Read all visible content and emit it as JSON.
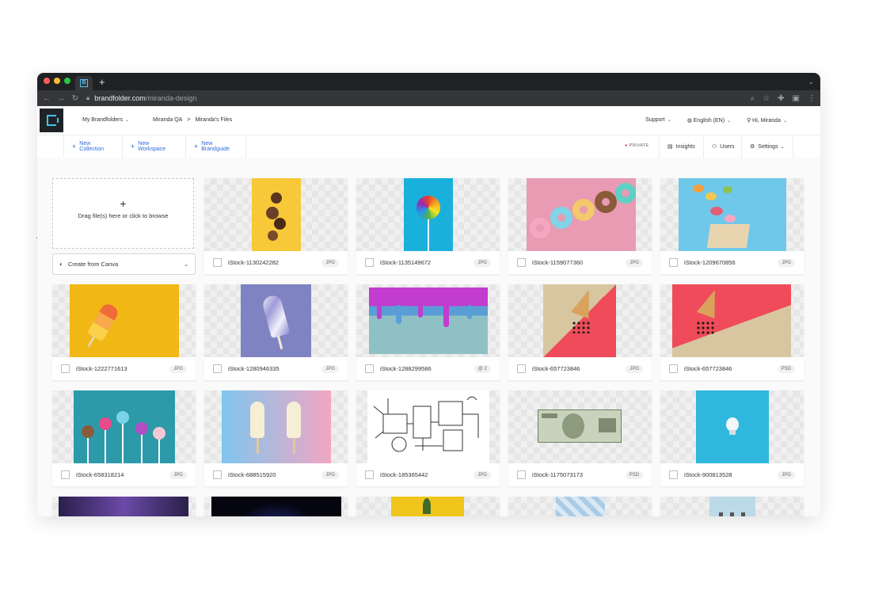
{
  "browser": {
    "tab_icon_letter": "B",
    "new_tab": "+",
    "url_domain": "brandfolder.com",
    "url_path": "/miranda-design"
  },
  "header": {
    "my_brandfolders": "My Brandfolders",
    "breadcrumb": [
      "Miranda QA",
      ">",
      "Miranda's Files"
    ],
    "support": "Support",
    "language": "English (EN)",
    "user": "Hi, Miranda"
  },
  "actions": {
    "new_collection": "New Collection",
    "new_workspace": "New Workspace",
    "new_brandguide": "New Brandguide",
    "private": "PRIVATE",
    "insights": "Insights",
    "users": "Users",
    "settings": "Settings"
  },
  "upload": {
    "plus": "+",
    "text": "Drag file(s) here or click to browse",
    "canva": "Create from Canva"
  },
  "assets": [
    {
      "name": "iStock-1130242282",
      "type": "JPG"
    },
    {
      "name": "iStock-1135149672",
      "type": "JPG"
    },
    {
      "name": "iStock-1159077360",
      "type": "JPG"
    },
    {
      "name": "iStock-1209670856",
      "type": "JPG"
    },
    {
      "name": "iStock-1222771613",
      "type": "JPG"
    },
    {
      "name": "iStock-1280946335",
      "type": "JPG"
    },
    {
      "name": "iStock-1288299586",
      "type": "@ 2"
    },
    {
      "name": "iStock-657723846",
      "type": "JPG"
    },
    {
      "name": "iStock-657723846",
      "type": "PSD"
    },
    {
      "name": "iStock-658318214",
      "type": "JPG"
    },
    {
      "name": "iStock-688515920",
      "type": "JPG"
    },
    {
      "name": "iStock-185365442",
      "type": "JPG"
    },
    {
      "name": "iStock-1175073173",
      "type": "PSD"
    },
    {
      "name": "iStock-900813528",
      "type": "JPG"
    }
  ],
  "colors": {
    "accent_blue": "#2f6bd8",
    "logo_cyan": "#42c5e8",
    "chrome_dark": "#202124"
  }
}
